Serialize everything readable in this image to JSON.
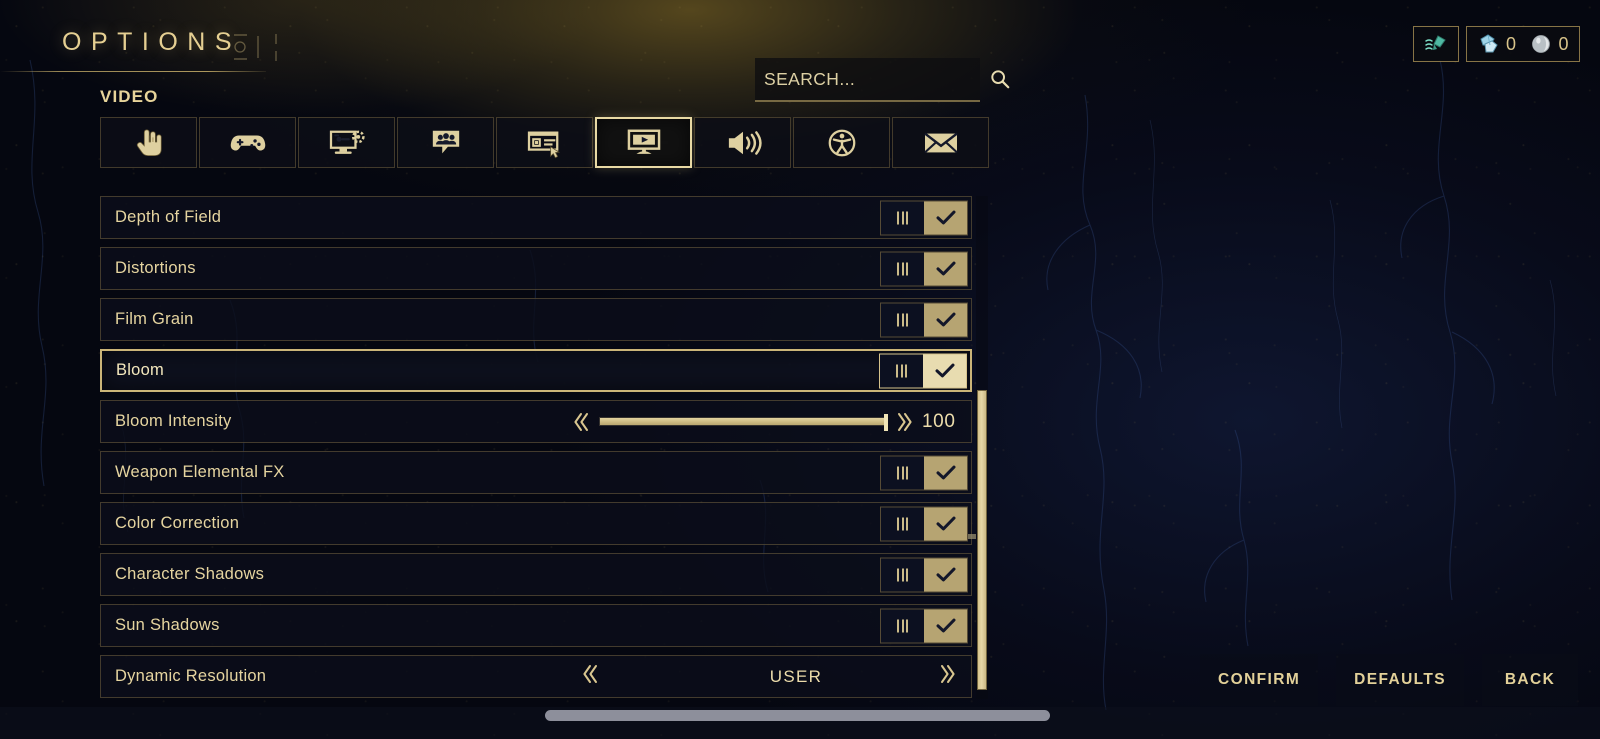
{
  "header": {
    "title": "OPTIONS",
    "category": "VIDEO",
    "title_deco_icon": "ornament-deco-icon",
    "divider": "title-divider"
  },
  "search": {
    "placeholder": "SEARCH...",
    "value": "",
    "icon": "search-icon"
  },
  "hud": {
    "boost_icon": "boost-pack-icon",
    "currencies": [
      {
        "icon": "crystal-shard-icon",
        "value": "0"
      },
      {
        "icon": "silver-orb-icon",
        "value": "0"
      }
    ]
  },
  "tabs": [
    {
      "id": "interface",
      "icon": "pointing-hand-icon",
      "selected": false
    },
    {
      "id": "controls",
      "icon": "gamepad-icon",
      "selected": false
    },
    {
      "id": "gameplay",
      "icon": "monitor-gear-icon",
      "selected": false
    },
    {
      "id": "social",
      "icon": "social-chat-icon",
      "selected": false
    },
    {
      "id": "hud",
      "icon": "hud-layout-icon",
      "selected": false
    },
    {
      "id": "video",
      "icon": "video-screen-icon",
      "selected": true
    },
    {
      "id": "audio",
      "icon": "speaker-icon",
      "selected": false
    },
    {
      "id": "accessibility",
      "icon": "accessibility-icon",
      "selected": false
    },
    {
      "id": "mail",
      "icon": "envelope-icon",
      "selected": false
    }
  ],
  "settings": [
    {
      "label": "Depth of Field",
      "type": "toggle",
      "value": "on",
      "selected": false
    },
    {
      "label": "Distortions",
      "type": "toggle",
      "value": "on",
      "selected": false
    },
    {
      "label": "Film Grain",
      "type": "toggle",
      "value": "on",
      "selected": false
    },
    {
      "label": "Bloom",
      "type": "toggle",
      "value": "on",
      "selected": true
    },
    {
      "label": "Bloom Intensity",
      "type": "slider",
      "value": "100",
      "percent": 100,
      "selected": false
    },
    {
      "label": "Weapon Elemental FX",
      "type": "toggle",
      "value": "on",
      "selected": false
    },
    {
      "label": "Color Correction",
      "type": "toggle",
      "value": "on",
      "selected": false
    },
    {
      "label": "Character Shadows",
      "type": "toggle",
      "value": "on",
      "selected": false
    },
    {
      "label": "Sun Shadows",
      "type": "toggle",
      "value": "on",
      "selected": false
    },
    {
      "label": "Dynamic Resolution",
      "type": "cycler",
      "value": "USER",
      "selected": false
    }
  ],
  "footer": {
    "buttons": [
      {
        "id": "confirm",
        "label": "CONFIRM"
      },
      {
        "id": "defaults",
        "label": "DEFAULTS"
      },
      {
        "id": "back",
        "label": "BACK"
      }
    ]
  },
  "scroll": {
    "vertical_thumb": "vertical-scrollbar-thumb",
    "horizontal_thumb": "horizontal-scrollbar-thumb"
  },
  "colors": {
    "gold": "#e6d5a0",
    "gold_bright": "#f4e8bd",
    "gold_fill": "#cdbb83",
    "bg_navy": "#0a0d1c",
    "row_bg": "#0b0e1a"
  }
}
